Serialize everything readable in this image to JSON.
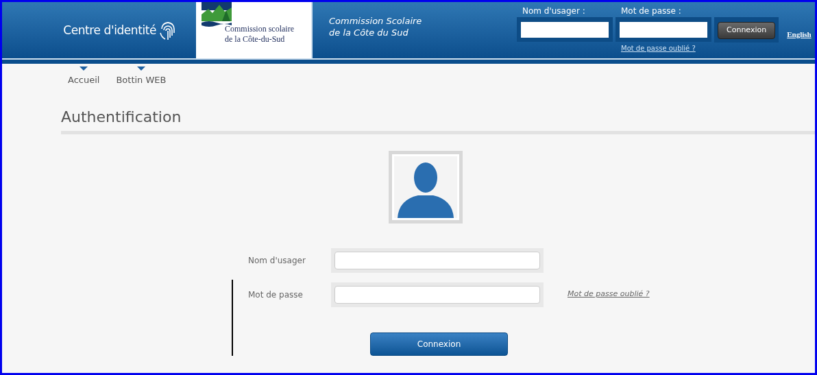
{
  "header": {
    "brand": "Centre d'identité",
    "logo_lines": [
      "Commission scolaire",
      "de la Côte-du-Sud"
    ],
    "org_lines": [
      "Commission Scolaire",
      "de la Côte du Sud"
    ],
    "login": {
      "username_label": "Nom d'usager :",
      "password_label": "Mot de passe :",
      "button": "Connexion",
      "forgot": "Mot de passe oublié ?"
    },
    "language": "English"
  },
  "nav": [
    {
      "label": "Accueil"
    },
    {
      "label": "Bottin WEB"
    }
  ],
  "title": "Authentification",
  "form": {
    "username_label": "Nom d'usager",
    "password_label": "Mot de passe",
    "forgot": "Mot de passe oublié ?",
    "button": "Connexion"
  }
}
